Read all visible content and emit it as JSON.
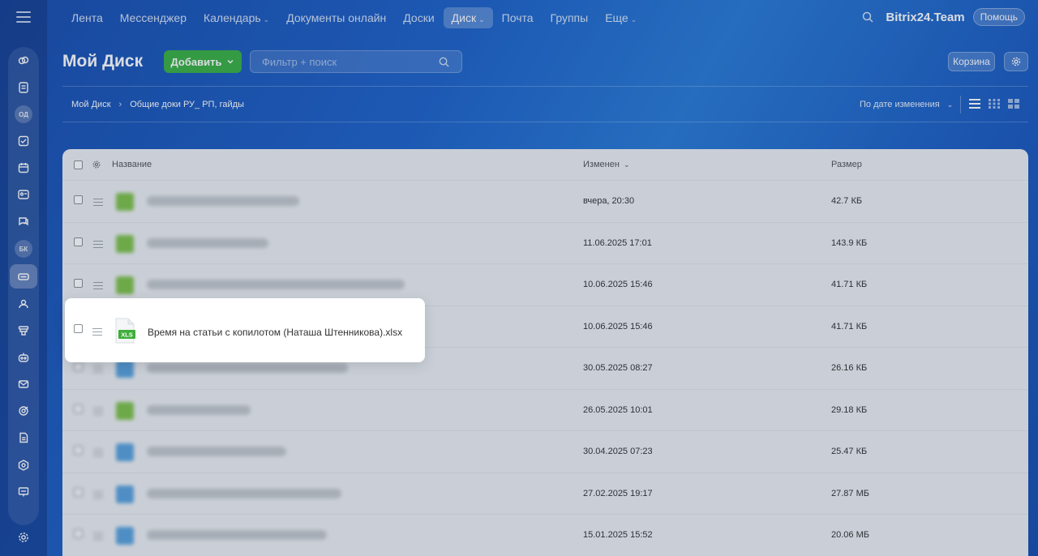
{
  "topnav": {
    "items": [
      {
        "label": "Лента",
        "caret": false,
        "active": false
      },
      {
        "label": "Мессенджер",
        "caret": false,
        "active": false
      },
      {
        "label": "Календарь",
        "caret": true,
        "active": false
      },
      {
        "label": "Документы онлайн",
        "caret": false,
        "active": false
      },
      {
        "label": "Доски",
        "caret": false,
        "active": false
      },
      {
        "label": "Диск",
        "caret": true,
        "active": true
      },
      {
        "label": "Почта",
        "caret": false,
        "active": false
      },
      {
        "label": "Группы",
        "caret": false,
        "active": false
      },
      {
        "label": "Еще",
        "caret": true,
        "active": false
      }
    ],
    "brand": "Bitrix24.Team",
    "help": "Помощь"
  },
  "sidebar": {
    "avatar_1": "ОД",
    "avatar_2": "БК",
    "icons": [
      "chat-bubbles-icon",
      "feed-icon",
      "tasks-icon",
      "calendar-icon",
      "contacts-card-icon",
      "messenger-icon",
      "drive-icon",
      "users-icon",
      "filter-icon",
      "robot-icon",
      "mail-icon",
      "target-icon",
      "document-icon",
      "hexagon-icon",
      "presentation-icon",
      "settings-icon"
    ]
  },
  "header": {
    "title": "Мой Диск",
    "add_label": "Добавить",
    "filter_placeholder": "Фильтр + поиск",
    "trash_label": "Корзина"
  },
  "breadcrumb": {
    "root": "Мой Диск",
    "current": "Общие доки РУ_ РП, гайды",
    "sort_label": "По дате изменения"
  },
  "table": {
    "col_name": "Название",
    "col_modified": "Изменен",
    "col_size": "Размер",
    "rows": [
      {
        "type": "green",
        "date": "вчера, 20:30",
        "size": "42.7 КБ"
      },
      {
        "type": "green",
        "date": "11.06.2025 17:01",
        "size": "143.9 КБ"
      },
      {
        "type": "green",
        "date": "10.06.2025 15:46",
        "size": "41.71 КБ"
      },
      {
        "type": "green",
        "date": "10.06.2025 15:46",
        "size": "41.71 КБ"
      },
      {
        "type": "blue",
        "date": "30.05.2025 08:27",
        "size": "26.16 КБ"
      },
      {
        "type": "green",
        "date": "26.05.2025 10:01",
        "size": "29.18 КБ"
      },
      {
        "type": "blue",
        "date": "30.04.2025 07:23",
        "size": "25.47 КБ"
      },
      {
        "type": "blue",
        "date": "27.02.2025 19:17",
        "size": "27.87 МБ"
      },
      {
        "type": "blue",
        "date": "15.01.2025 15:52",
        "size": "20.06 МБ"
      }
    ],
    "highlight": {
      "name": "Время на статьи с копилотом (Наташа Штенникова).xlsx",
      "icon_label": "XLS"
    }
  },
  "colors": {
    "accent_green": "#3bb143",
    "bg_blue": "#1f63c9",
    "xls_green": "#3fae3a"
  }
}
